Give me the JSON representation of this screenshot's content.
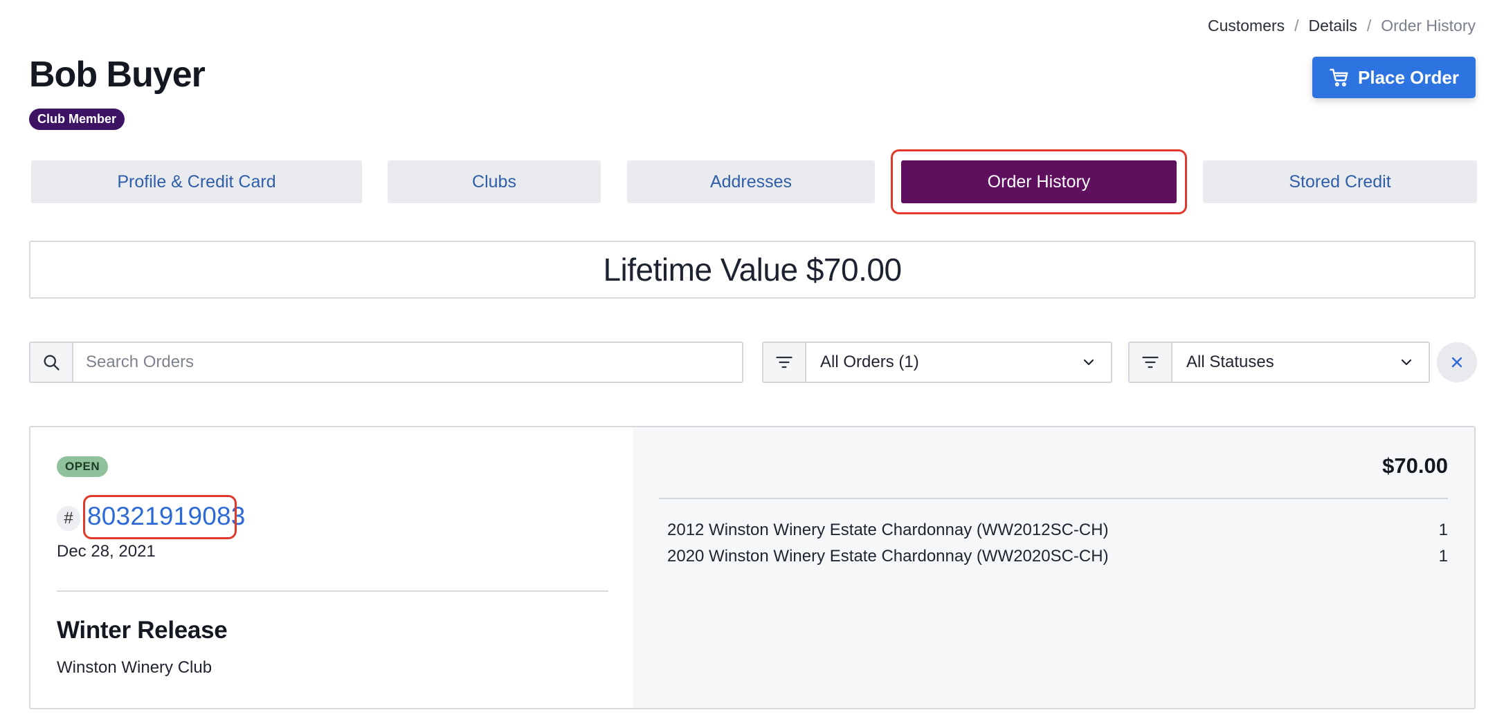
{
  "breadcrumb": {
    "items": [
      "Customers",
      "Details",
      "Order History"
    ],
    "separator": "/"
  },
  "customer": {
    "name": "Bob Buyer",
    "badge": "Club Member"
  },
  "actions": {
    "place_order_label": "Place Order",
    "place_order_icon": "cart-icon"
  },
  "tabs": [
    {
      "label": "Profile & Credit Card",
      "active": false
    },
    {
      "label": "Clubs",
      "active": false
    },
    {
      "label": "Addresses",
      "active": false
    },
    {
      "label": "Order History",
      "active": true
    },
    {
      "label": "Stored Credit",
      "active": false
    }
  ],
  "lifetime_value": "Lifetime Value $70.00",
  "filters": {
    "search_placeholder": "Search Orders",
    "order_type_value": "All Orders (1)",
    "status_value": "All Statuses"
  },
  "orders": [
    {
      "status": "OPEN",
      "hash": "#",
      "number": "80321919083",
      "date": "Dec 28, 2021",
      "release_title": "Winter Release",
      "club_name": "Winston Winery Club",
      "total": "$70.00",
      "items": [
        {
          "name": "2012 Winston Winery Estate Chardonnay (WW2012SC-CH)",
          "qty": "1"
        },
        {
          "name": "2020 Winston Winery Estate Chardonnay (WW2020SC-CH)",
          "qty": "1"
        }
      ]
    }
  ],
  "colors": {
    "brand_purple": "#5e0f5e",
    "club_badge": "#3d1464",
    "primary_blue": "#2d74e0",
    "link_blue": "#2d6ad6",
    "open_badge": "#8fc19c",
    "highlight_red": "#e0392a"
  }
}
